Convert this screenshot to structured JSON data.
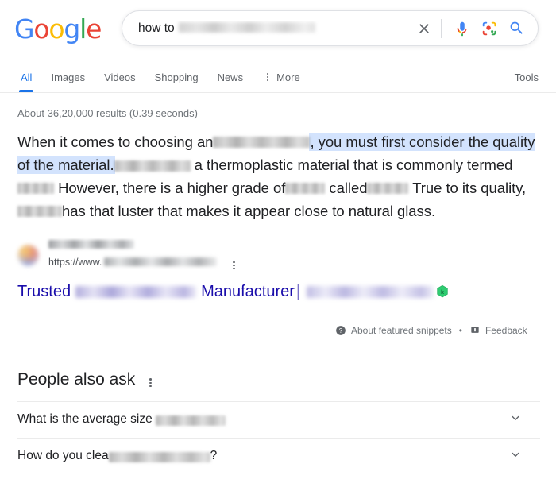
{
  "logo": {
    "name": "Google",
    "letters": [
      {
        "char": "G",
        "color": "#4285f4"
      },
      {
        "char": "o",
        "color": "#ea4335"
      },
      {
        "char": "o",
        "color": "#fbbc05"
      },
      {
        "char": "g",
        "color": "#4285f4"
      },
      {
        "char": "l",
        "color": "#34a853"
      },
      {
        "char": "e",
        "color": "#ea4335"
      }
    ]
  },
  "search": {
    "query_visible": "how to",
    "query_redacted": true,
    "placeholder": "Search",
    "clear_label": "Clear",
    "voice_label": "Search by voice",
    "lens_label": "Search by image",
    "search_label": "Google Search"
  },
  "nav": {
    "items": [
      {
        "label": "All",
        "active": true
      },
      {
        "label": "Images",
        "active": false
      },
      {
        "label": "Videos",
        "active": false
      },
      {
        "label": "Shopping",
        "active": false
      },
      {
        "label": "News",
        "active": false
      }
    ],
    "more_label": "More",
    "tools_label": "Tools"
  },
  "results": {
    "stats": "About 36,20,000 results (0.39 seconds)",
    "snippet": {
      "part1": "When it comes to choosing an",
      "highlight1": ", you must first consider the quality of the material.",
      "part2": "a thermoplastic material that is commonly termed",
      "part3": "However, there is a higher grade of",
      "part4": "called",
      "part5": "True to its quality,",
      "part6": "has that luster that makes it appear close to natural glass."
    },
    "source": {
      "site_name_redacted": true,
      "url_visible": "https://www.",
      "url_redacted": true,
      "menu_label": "About this result"
    },
    "title": {
      "prefix": "Trusted",
      "middle": "Manufacturer",
      "separator": "|",
      "badge": "verified-hex-badge"
    },
    "footer": {
      "about_label": "About featured snippets",
      "separator": "•",
      "feedback_label": "Feedback"
    }
  },
  "people_also_ask": {
    "title": "People also ask",
    "menu_label": "More options",
    "questions": [
      {
        "visible_text": "What is the average size",
        "trailing": "",
        "redact_class": "q1"
      },
      {
        "visible_text": "How do you clea",
        "trailing": "?",
        "redact_class": "q2"
      }
    ]
  },
  "colors": {
    "link_blue": "#1a0dab",
    "tab_blue": "#1a73e8",
    "highlight_blue": "#d3e3fd",
    "text_gray": "#70757a",
    "badge_green": "#34c759"
  }
}
